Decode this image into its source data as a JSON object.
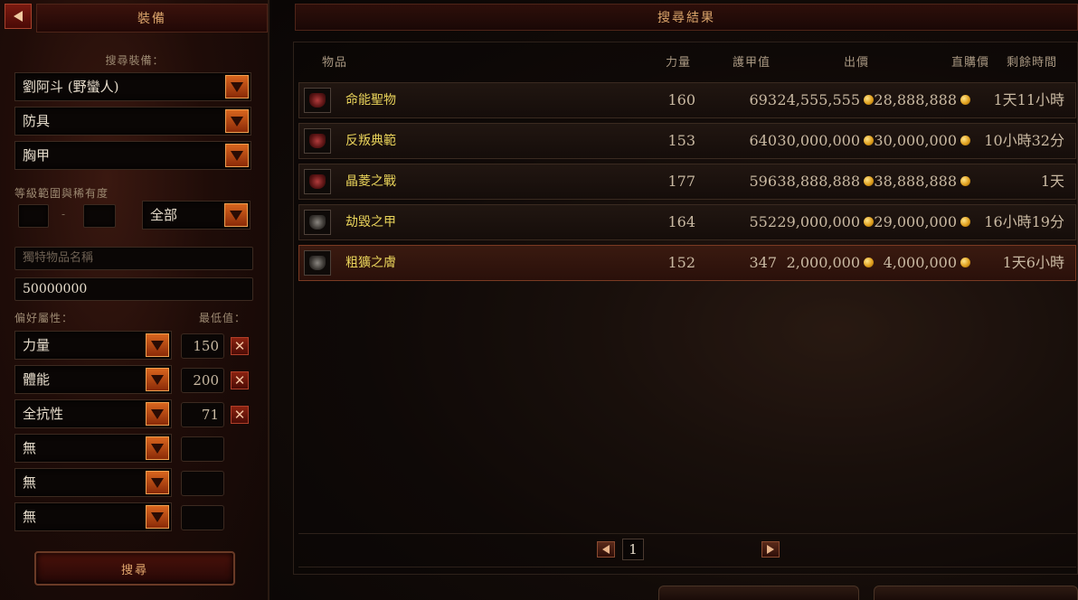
{
  "left_panel": {
    "title": "裝備",
    "search_label": "搜尋裝備：",
    "character_dropdown": "劉阿斗 (野蠻人)",
    "category_dropdown": "防具",
    "subtype_dropdown": "胸甲",
    "level_rarity_label": "等級範圍與稀有度",
    "level_separator": "-",
    "rarity_dropdown": "全部",
    "unique_name_placeholder": "獨特物品名稱",
    "price_value": "50000000",
    "pref_attr_label": "偏好屬性：",
    "min_value_label": "最低值：",
    "attributes": [
      {
        "name": "力量",
        "min": "150",
        "removable": true
      },
      {
        "name": "體能",
        "min": "200",
        "removable": true
      },
      {
        "name": "全抗性",
        "min": "71",
        "removable": true
      },
      {
        "name": "無",
        "min": "",
        "removable": false
      },
      {
        "name": "無",
        "min": "",
        "removable": false
      },
      {
        "name": "無",
        "min": "",
        "removable": false
      }
    ],
    "remove_symbol": "✕",
    "search_button": "搜尋"
  },
  "results": {
    "title": "搜尋結果",
    "columns": {
      "item": "物品",
      "strength": "力量",
      "armor": "護甲值",
      "bid": "出價",
      "buyout": "直購價",
      "time_left": "剩餘時間"
    },
    "rows": [
      {
        "icon": "red-armor-icon",
        "name": "命能聖物",
        "strength": "160",
        "armor": "693",
        "bid": "24,555,555",
        "buyout": "28,888,888",
        "time_left": "1天11小時",
        "selected": false
      },
      {
        "icon": "red-armor-icon",
        "name": "反叛典範",
        "strength": "153",
        "armor": "640",
        "bid": "30,000,000",
        "buyout": "30,000,000",
        "time_left": "10小時32分",
        "selected": false
      },
      {
        "icon": "red-armor-icon",
        "name": "晶菱之戰",
        "strength": "177",
        "armor": "596",
        "bid": "38,888,888",
        "buyout": "38,888,888",
        "time_left": "1天",
        "selected": false
      },
      {
        "icon": "gray-armor-icon",
        "name": "劫毀之甲",
        "strength": "164",
        "armor": "552",
        "bid": "29,000,000",
        "buyout": "29,000,000",
        "time_left": "16小時19分",
        "selected": false
      },
      {
        "icon": "gray-armor-icon",
        "name": "粗獷之膚",
        "strength": "152",
        "armor": "347",
        "bid": "2,000,000",
        "buyout": "4,000,000",
        "time_left": "1天6小時",
        "selected": true
      }
    ],
    "page": "1"
  },
  "colors": {
    "accent_orange": "#d8651e",
    "item_name_yellow": "#e8d25a",
    "header_gold": "#d9a36a",
    "gold_coin": "#e0a01e"
  }
}
